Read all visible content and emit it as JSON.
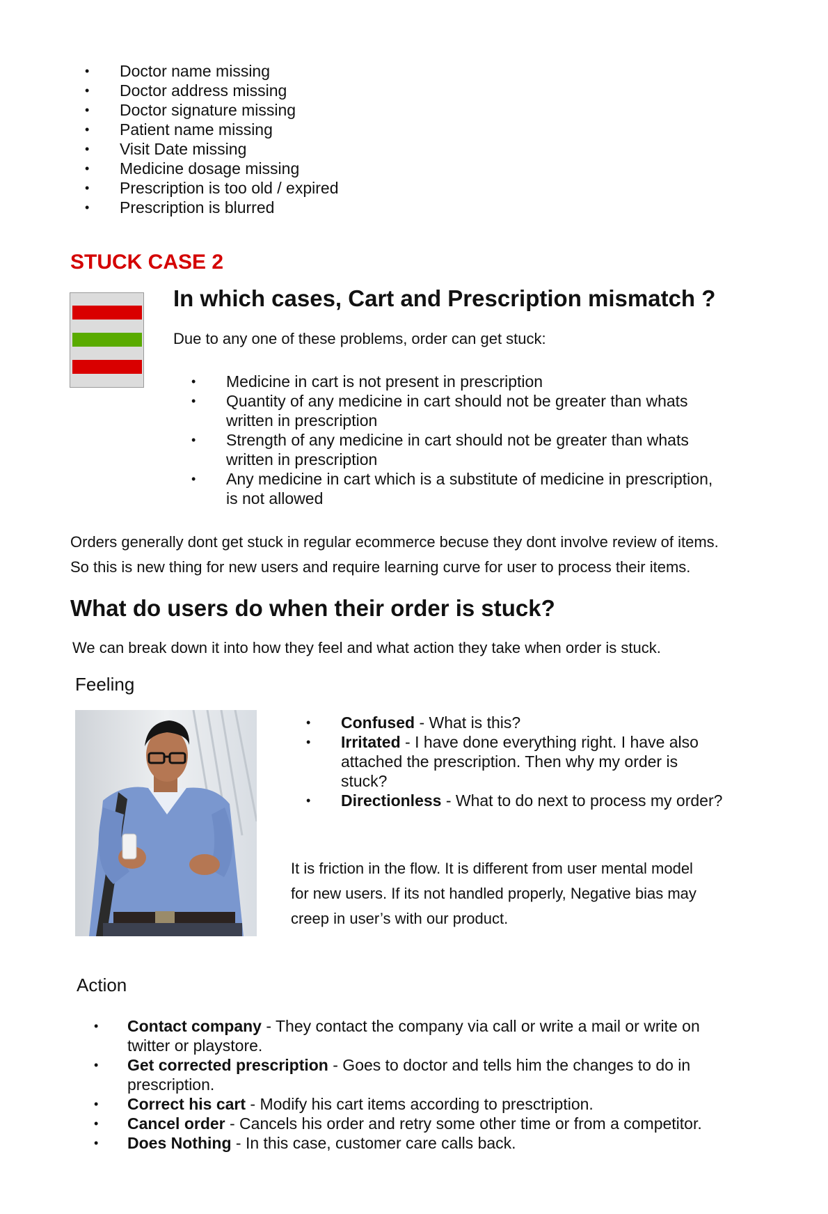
{
  "bullet_glyph": "•",
  "top_list": [
    "Doctor name missing",
    "Doctor address missing",
    "Doctor signature missing",
    "Patient name missing",
    "Visit Date missing",
    "Medicine dosage missing",
    "Prescription is too old / expired",
    "Prescription is blurred"
  ],
  "stuck_case": {
    "title": "STUCK CASE 2",
    "title_color": "#d40000",
    "icon": {
      "name": "stuck-status-icon",
      "colors": [
        "#d90000",
        "#5aab00",
        "#d90000"
      ]
    },
    "heading": "In which cases, Cart and Prescription mismatch ?",
    "intro": "Due to any one of these problems, order can get stuck:",
    "items": [
      [
        "Medicine in cart is not present in prescription"
      ],
      [
        "Quantity of any medicine in cart should not be greater than whats",
        "written in prescription"
      ],
      [
        "Strength of any medicine in cart should not be greater than whats",
        "written in prescription"
      ],
      [
        "Any medicine in cart which is a substitute of medicine in prescription,",
        "is not allowed"
      ]
    ]
  },
  "para1": [
    "Orders generally dont get stuck in regular ecommerce becuse they dont involve review of items.",
    "So this is new thing for new users and require learning curve for user to process their items."
  ],
  "users_section": {
    "heading": "What do users do when their order is stuck?",
    "intro": "We can break down it into how they feel and what action they take when order is stuck.",
    "feeling_label": "Feeling",
    "feelings": [
      {
        "term": "Confused",
        "lines": [
          " - What is this?"
        ]
      },
      {
        "term": "Irritated",
        "lines": [
          " - I have done everything right. I have also",
          "attached the prescription. Then why my order is",
          "stuck?"
        ]
      },
      {
        "term": "Directionless",
        "lines": [
          " - What to do next to process my order?"
        ]
      }
    ],
    "para2": [
      "It is friction in the flow. It is different from user mental model",
      "for new users. If its not handled properly, Negative bias may",
      "creep in user’s with our product."
    ],
    "action_label": "Action",
    "actions": [
      {
        "term": "Contact company",
        "lines": [
          " - They contact the company via call or write a mail or write on",
          "twitter or playstore."
        ]
      },
      {
        "term": "Get corrected prescription",
        "lines": [
          " - Goes to doctor and tells him the changes to do in",
          "prescription."
        ]
      },
      {
        "term": "Correct his cart",
        "lines": [
          " - Modify his cart items according to presctription."
        ]
      },
      {
        "term": "Cancel order",
        "lines": [
          " - Cancels his order and retry some other time or from a competitor."
        ]
      },
      {
        "term": "Does Nothing",
        "lines": [
          " - In this case, customer care calls back."
        ]
      }
    ]
  }
}
